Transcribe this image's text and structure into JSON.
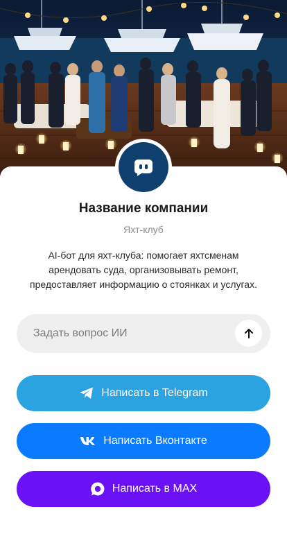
{
  "company": {
    "name": "Название компании",
    "category": "Яхт-клуб",
    "description_lines": [
      "AI-бот для яхт-клуба: помогает яхтсменам",
      "арендовать суда, организовывать ремонт,",
      "предоставляет информацию о стоянках и услугах."
    ]
  },
  "hero": {
    "image_icon": "yacht-club-party-photo"
  },
  "avatar": {
    "icon": "chat-bot-icon",
    "color": "#0f3f6e"
  },
  "ask": {
    "placeholder": "Задать вопрос ИИ",
    "value": "",
    "send_icon": "arrow-up-icon"
  },
  "buttons": {
    "telegram": {
      "label": "Написать в Telegram",
      "icon": "telegram-icon",
      "color": "#2aa3e0"
    },
    "vk": {
      "label": "Написать Вконтакте",
      "icon": "vk-icon",
      "color": "#0a7bff"
    },
    "max": {
      "label": "Написать в MAX",
      "icon": "max-icon",
      "color": "#6a11f5"
    }
  }
}
